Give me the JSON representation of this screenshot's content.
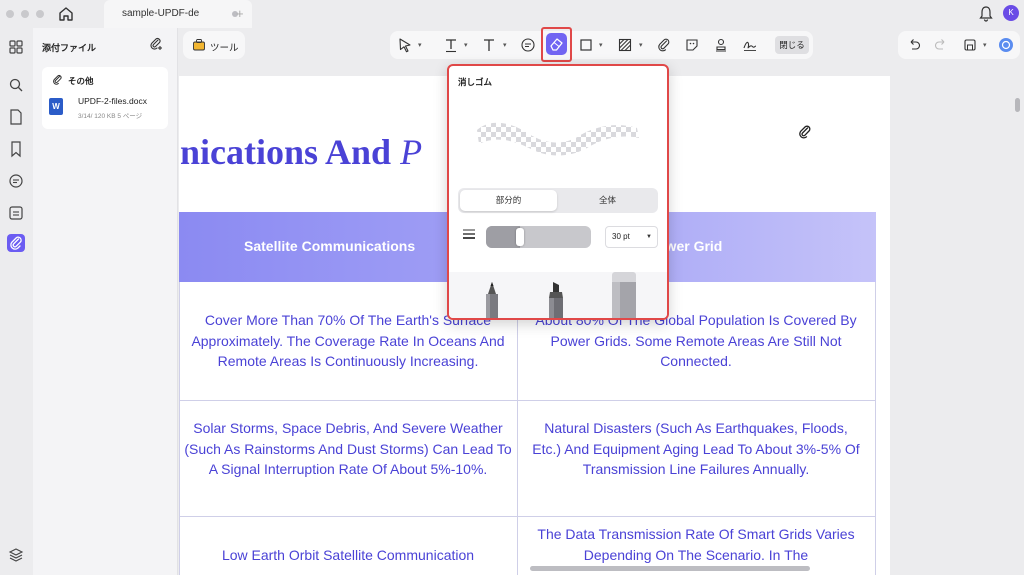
{
  "window": {
    "tab_title": "sample-UPDF-de",
    "tab_add": "+",
    "avatar_initial": "K"
  },
  "rail": {
    "items": [
      "grid-icon",
      "search-icon",
      "pages-icon",
      "bookmark-icon",
      "comment-icon",
      "form-icon",
      "attachment-icon"
    ],
    "active": "attachment-icon",
    "bottom": "layers-icon"
  },
  "panel": {
    "title": "添付ファイル",
    "group_label": "その他",
    "file": {
      "icon_letter": "W",
      "name": "UPDF-2-files.docx",
      "meta": "3/14/  120 KB  5 ページ"
    }
  },
  "toolbar": {
    "tool_label": "ツール",
    "close_label": "閉じる",
    "active_tool": "eraser",
    "accent": "#7165f2"
  },
  "eraser_popup": {
    "title": "消しゴム",
    "mode_partial": "部分的",
    "mode_whole": "全体",
    "selected_mode": "部分的",
    "size_value": "30 pt",
    "size_fraction": 0.3,
    "tools": [
      "pen-tool",
      "marker-tool",
      "eraser-tool"
    ]
  },
  "document": {
    "title_main": "nications And ",
    "title_italic": "P",
    "header_left": "Satellite Communications",
    "header_right": "ower Grid",
    "rows": [
      {
        "left": "Cover More Than 70% Of The Earth's Surface Approximately. The Coverage Rate In Oceans And Remote Areas Is Continuously Increasing.",
        "right": "About 80% Of The Global Population Is Covered By Power Grids. Some Remote Areas Are Still Not Connected."
      },
      {
        "left": "Solar Storms, Space Debris, And Severe Weather (Such As Rainstorms And Dust Storms) Can Lead To A Signal Interruption Rate Of About 5%-10%.",
        "right": "Natural Disasters (Such As Earthquakes, Floods, Etc.) And Equipment Aging Lead To About 3%-5% Of Transmission Line Failures Annually."
      },
      {
        "left": "Low Earth Orbit Satellite Communication",
        "right": "The Data Transmission Rate Of Smart Grids Varies Depending On The Scenario. In The"
      }
    ],
    "text_color": "#4a42d6",
    "header_color": "#8b8af2"
  }
}
